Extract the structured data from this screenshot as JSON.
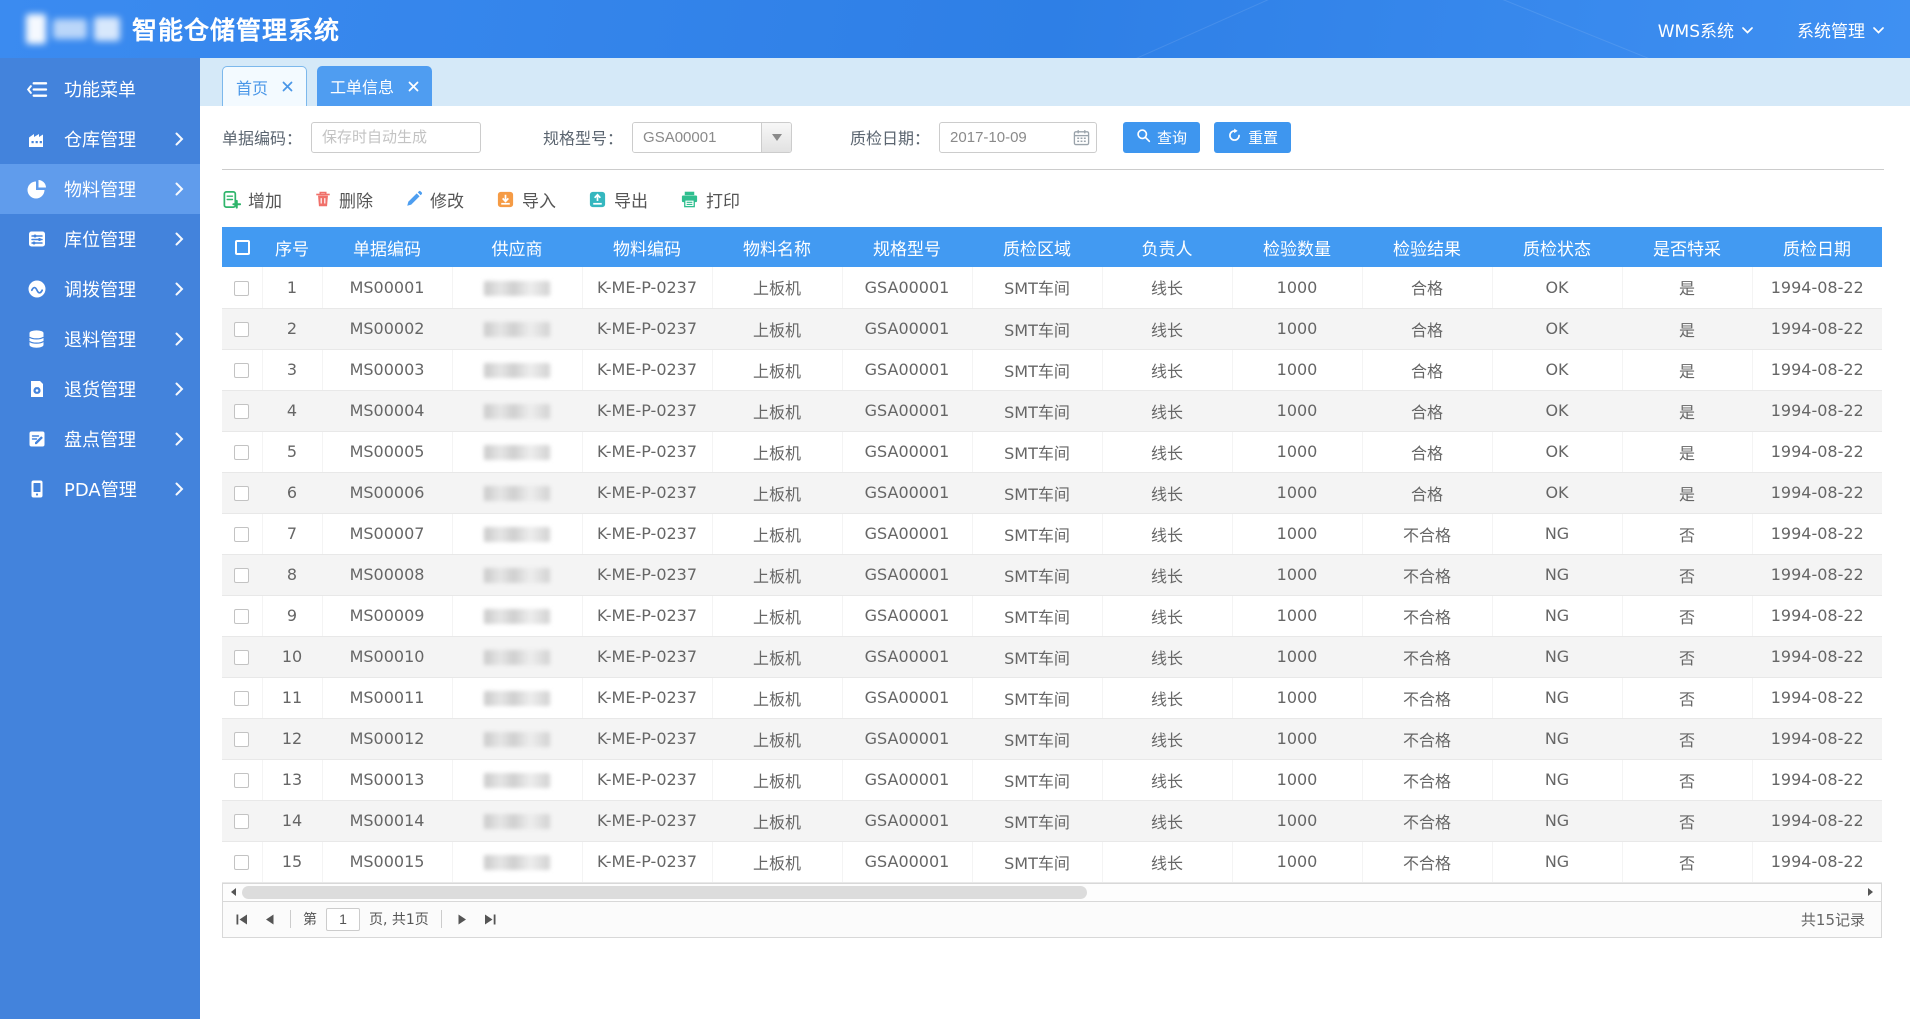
{
  "colors": {
    "accent": "#3E96EF",
    "header_bar": "#3486EC",
    "sidebar": "#4383DC",
    "sidebar_active": "#609CEC",
    "tab_strip": "#D5E9F8",
    "tab_active": "#4F9DF1",
    "table_header": "#429AF2"
  },
  "header": {
    "title": "智能仓储管理系统",
    "menus": [
      {
        "label": "WMS系统"
      },
      {
        "label": "系统管理"
      }
    ]
  },
  "sidebar": {
    "items": [
      {
        "key": "menu",
        "icon": "menu-icon",
        "label": "功能菜单",
        "active": false,
        "chevron": false
      },
      {
        "key": "warehouse",
        "icon": "warehouse-icon",
        "label": "仓库管理",
        "active": false,
        "chevron": true
      },
      {
        "key": "material",
        "icon": "pie-chart-icon",
        "label": "物料管理",
        "active": true,
        "chevron": true
      },
      {
        "key": "location",
        "icon": "sliders-icon",
        "label": "库位管理",
        "active": false,
        "chevron": true
      },
      {
        "key": "transfer",
        "icon": "transfer-icon",
        "label": "调拨管理",
        "active": false,
        "chevron": true
      },
      {
        "key": "material-return",
        "icon": "database-icon",
        "label": "退料管理",
        "active": false,
        "chevron": true
      },
      {
        "key": "goods-return",
        "icon": "return-doc-icon",
        "label": "退货管理",
        "active": false,
        "chevron": true
      },
      {
        "key": "stocktake",
        "icon": "edit-doc-icon",
        "label": "盘点管理",
        "active": false,
        "chevron": true
      },
      {
        "key": "pda",
        "icon": "pda-icon",
        "label": "PDA管理",
        "active": false,
        "chevron": true
      }
    ]
  },
  "tabs": [
    {
      "key": "home",
      "label": "首页",
      "active": false
    },
    {
      "key": "work-order",
      "label": "工单信息",
      "active": true
    }
  ],
  "filters": {
    "doc_code_label": "单据编码：",
    "doc_code_placeholder": "保存时自动生成",
    "spec_label": "规格型号：",
    "spec_value": "GSA00001",
    "date_label": "质检日期：",
    "date_value": "2017-10-09",
    "search_label": "查询",
    "reset_label": "重置"
  },
  "toolbar": [
    {
      "key": "add",
      "icon": "add-icon",
      "label": "增加"
    },
    {
      "key": "delete",
      "icon": "delete-icon",
      "label": "删除"
    },
    {
      "key": "edit",
      "icon": "edit-icon",
      "label": "修改"
    },
    {
      "key": "import",
      "icon": "import-icon",
      "label": "导入"
    },
    {
      "key": "export",
      "icon": "export-icon",
      "label": "导出"
    },
    {
      "key": "print",
      "icon": "print-icon",
      "label": "打印"
    }
  ],
  "table": {
    "columns": [
      "序号",
      "单据编码",
      "供应商",
      "物料编码",
      "物料名称",
      "规格型号",
      "质检区域",
      "负责人",
      "检验数量",
      "检验结果",
      "质检状态",
      "是否特采",
      "质检日期"
    ],
    "supplier_column_blurred": true,
    "rows": [
      [
        "1",
        "MS00001",
        "",
        "K-ME-P-0237",
        "上板机",
        "GSA00001",
        "SMT车间",
        "线长",
        "1000",
        "合格",
        "OK",
        "是",
        "1994-08-22"
      ],
      [
        "2",
        "MS00002",
        "",
        "K-ME-P-0237",
        "上板机",
        "GSA00001",
        "SMT车间",
        "线长",
        "1000",
        "合格",
        "OK",
        "是",
        "1994-08-22"
      ],
      [
        "3",
        "MS00003",
        "",
        "K-ME-P-0237",
        "上板机",
        "GSA00001",
        "SMT车间",
        "线长",
        "1000",
        "合格",
        "OK",
        "是",
        "1994-08-22"
      ],
      [
        "4",
        "MS00004",
        "",
        "K-ME-P-0237",
        "上板机",
        "GSA00001",
        "SMT车间",
        "线长",
        "1000",
        "合格",
        "OK",
        "是",
        "1994-08-22"
      ],
      [
        "5",
        "MS00005",
        "",
        "K-ME-P-0237",
        "上板机",
        "GSA00001",
        "SMT车间",
        "线长",
        "1000",
        "合格",
        "OK",
        "是",
        "1994-08-22"
      ],
      [
        "6",
        "MS00006",
        "",
        "K-ME-P-0237",
        "上板机",
        "GSA00001",
        "SMT车间",
        "线长",
        "1000",
        "合格",
        "OK",
        "是",
        "1994-08-22"
      ],
      [
        "7",
        "MS00007",
        "",
        "K-ME-P-0237",
        "上板机",
        "GSA00001",
        "SMT车间",
        "线长",
        "1000",
        "不合格",
        "NG",
        "否",
        "1994-08-22"
      ],
      [
        "8",
        "MS00008",
        "",
        "K-ME-P-0237",
        "上板机",
        "GSA00001",
        "SMT车间",
        "线长",
        "1000",
        "不合格",
        "NG",
        "否",
        "1994-08-22"
      ],
      [
        "9",
        "MS00009",
        "",
        "K-ME-P-0237",
        "上板机",
        "GSA00001",
        "SMT车间",
        "线长",
        "1000",
        "不合格",
        "NG",
        "否",
        "1994-08-22"
      ],
      [
        "10",
        "MS00010",
        "",
        "K-ME-P-0237",
        "上板机",
        "GSA00001",
        "SMT车间",
        "线长",
        "1000",
        "不合格",
        "NG",
        "否",
        "1994-08-22"
      ],
      [
        "11",
        "MS00011",
        "",
        "K-ME-P-0237",
        "上板机",
        "GSA00001",
        "SMT车间",
        "线长",
        "1000",
        "不合格",
        "NG",
        "否",
        "1994-08-22"
      ],
      [
        "12",
        "MS00012",
        "",
        "K-ME-P-0237",
        "上板机",
        "GSA00001",
        "SMT车间",
        "线长",
        "1000",
        "不合格",
        "NG",
        "否",
        "1994-08-22"
      ],
      [
        "13",
        "MS00013",
        "",
        "K-ME-P-0237",
        "上板机",
        "GSA00001",
        "SMT车间",
        "线长",
        "1000",
        "不合格",
        "NG",
        "否",
        "1994-08-22"
      ],
      [
        "14",
        "MS00014",
        "",
        "K-ME-P-0237",
        "上板机",
        "GSA00001",
        "SMT车间",
        "线长",
        "1000",
        "不合格",
        "NG",
        "否",
        "1994-08-22"
      ],
      [
        "15",
        "MS00015",
        "",
        "K-ME-P-0237",
        "上板机",
        "GSA00001",
        "SMT车间",
        "线长",
        "1000",
        "不合格",
        "NG",
        "否",
        "1994-08-22"
      ]
    ]
  },
  "pagination": {
    "page_prefix": "第",
    "page_value": "1",
    "page_suffix": "页, 共1页",
    "total_label": "共15记录"
  }
}
